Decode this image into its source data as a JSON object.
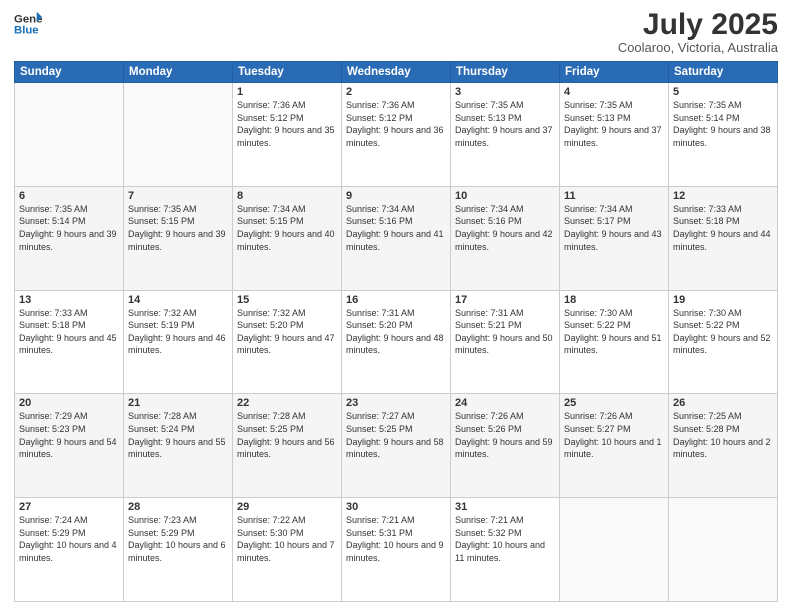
{
  "header": {
    "logo_line1": "General",
    "logo_line2": "Blue",
    "month_year": "July 2025",
    "location": "Coolaroo, Victoria, Australia"
  },
  "weekdays": [
    "Sunday",
    "Monday",
    "Tuesday",
    "Wednesday",
    "Thursday",
    "Friday",
    "Saturday"
  ],
  "weeks": [
    [
      {
        "day": "",
        "empty": true
      },
      {
        "day": "",
        "empty": true
      },
      {
        "day": "1",
        "sunrise": "7:36 AM",
        "sunset": "5:12 PM",
        "daylight": "9 hours and 35 minutes."
      },
      {
        "day": "2",
        "sunrise": "7:36 AM",
        "sunset": "5:12 PM",
        "daylight": "9 hours and 36 minutes."
      },
      {
        "day": "3",
        "sunrise": "7:35 AM",
        "sunset": "5:13 PM",
        "daylight": "9 hours and 37 minutes."
      },
      {
        "day": "4",
        "sunrise": "7:35 AM",
        "sunset": "5:13 PM",
        "daylight": "9 hours and 37 minutes."
      },
      {
        "day": "5",
        "sunrise": "7:35 AM",
        "sunset": "5:14 PM",
        "daylight": "9 hours and 38 minutes."
      }
    ],
    [
      {
        "day": "6",
        "sunrise": "7:35 AM",
        "sunset": "5:14 PM",
        "daylight": "9 hours and 39 minutes."
      },
      {
        "day": "7",
        "sunrise": "7:35 AM",
        "sunset": "5:15 PM",
        "daylight": "9 hours and 39 minutes."
      },
      {
        "day": "8",
        "sunrise": "7:34 AM",
        "sunset": "5:15 PM",
        "daylight": "9 hours and 40 minutes."
      },
      {
        "day": "9",
        "sunrise": "7:34 AM",
        "sunset": "5:16 PM",
        "daylight": "9 hours and 41 minutes."
      },
      {
        "day": "10",
        "sunrise": "7:34 AM",
        "sunset": "5:16 PM",
        "daylight": "9 hours and 42 minutes."
      },
      {
        "day": "11",
        "sunrise": "7:34 AM",
        "sunset": "5:17 PM",
        "daylight": "9 hours and 43 minutes."
      },
      {
        "day": "12",
        "sunrise": "7:33 AM",
        "sunset": "5:18 PM",
        "daylight": "9 hours and 44 minutes."
      }
    ],
    [
      {
        "day": "13",
        "sunrise": "7:33 AM",
        "sunset": "5:18 PM",
        "daylight": "9 hours and 45 minutes."
      },
      {
        "day": "14",
        "sunrise": "7:32 AM",
        "sunset": "5:19 PM",
        "daylight": "9 hours and 46 minutes."
      },
      {
        "day": "15",
        "sunrise": "7:32 AM",
        "sunset": "5:20 PM",
        "daylight": "9 hours and 47 minutes."
      },
      {
        "day": "16",
        "sunrise": "7:31 AM",
        "sunset": "5:20 PM",
        "daylight": "9 hours and 48 minutes."
      },
      {
        "day": "17",
        "sunrise": "7:31 AM",
        "sunset": "5:21 PM",
        "daylight": "9 hours and 50 minutes."
      },
      {
        "day": "18",
        "sunrise": "7:30 AM",
        "sunset": "5:22 PM",
        "daylight": "9 hours and 51 minutes."
      },
      {
        "day": "19",
        "sunrise": "7:30 AM",
        "sunset": "5:22 PM",
        "daylight": "9 hours and 52 minutes."
      }
    ],
    [
      {
        "day": "20",
        "sunrise": "7:29 AM",
        "sunset": "5:23 PM",
        "daylight": "9 hours and 54 minutes."
      },
      {
        "day": "21",
        "sunrise": "7:28 AM",
        "sunset": "5:24 PM",
        "daylight": "9 hours and 55 minutes."
      },
      {
        "day": "22",
        "sunrise": "7:28 AM",
        "sunset": "5:25 PM",
        "daylight": "9 hours and 56 minutes."
      },
      {
        "day": "23",
        "sunrise": "7:27 AM",
        "sunset": "5:25 PM",
        "daylight": "9 hours and 58 minutes."
      },
      {
        "day": "24",
        "sunrise": "7:26 AM",
        "sunset": "5:26 PM",
        "daylight": "9 hours and 59 minutes."
      },
      {
        "day": "25",
        "sunrise": "7:26 AM",
        "sunset": "5:27 PM",
        "daylight": "10 hours and 1 minute."
      },
      {
        "day": "26",
        "sunrise": "7:25 AM",
        "sunset": "5:28 PM",
        "daylight": "10 hours and 2 minutes."
      }
    ],
    [
      {
        "day": "27",
        "sunrise": "7:24 AM",
        "sunset": "5:29 PM",
        "daylight": "10 hours and 4 minutes."
      },
      {
        "day": "28",
        "sunrise": "7:23 AM",
        "sunset": "5:29 PM",
        "daylight": "10 hours and 6 minutes."
      },
      {
        "day": "29",
        "sunrise": "7:22 AM",
        "sunset": "5:30 PM",
        "daylight": "10 hours and 7 minutes."
      },
      {
        "day": "30",
        "sunrise": "7:21 AM",
        "sunset": "5:31 PM",
        "daylight": "10 hours and 9 minutes."
      },
      {
        "day": "31",
        "sunrise": "7:21 AM",
        "sunset": "5:32 PM",
        "daylight": "10 hours and 11 minutes."
      },
      {
        "day": "",
        "empty": true
      },
      {
        "day": "",
        "empty": true
      }
    ]
  ]
}
